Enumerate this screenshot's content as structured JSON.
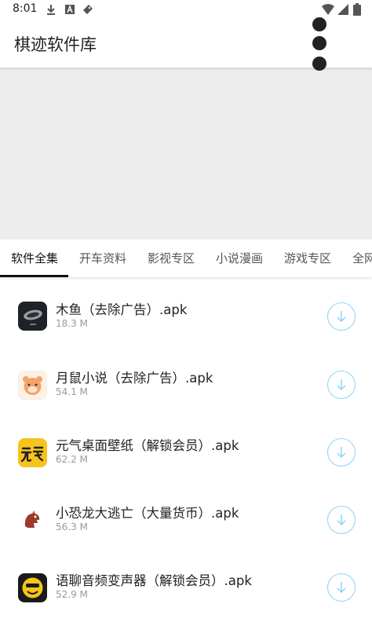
{
  "status_bar": {
    "time": "8:01",
    "left_icons": [
      "download-icon",
      "a-notification-icon",
      "tag-icon"
    ],
    "right_icons": [
      "wifi-icon",
      "signal-icon",
      "battery-icon"
    ]
  },
  "app_bar": {
    "title": "棋迹软件库",
    "menu_icon": "more-vert-icon"
  },
  "tabs": [
    {
      "label": "软件全集",
      "active": true
    },
    {
      "label": "开车资料",
      "active": false
    },
    {
      "label": "影视专区",
      "active": false
    },
    {
      "label": "小说漫画",
      "active": false
    },
    {
      "label": "游戏专区",
      "active": false
    },
    {
      "label": "全网",
      "active": false
    }
  ],
  "apps": [
    {
      "name": "木鱼（去除广告）.apk",
      "size": "18.3 M",
      "icon": "wooden-fish-app-icon"
    },
    {
      "name": "月鼠小说（去除广告）.apk",
      "size": "54.1 M",
      "icon": "hamster-app-icon"
    },
    {
      "name": "元气桌面壁纸（解锁会员）.apk",
      "size": "62.2 M",
      "icon": "yuanqi-app-icon"
    },
    {
      "name": "小恐龙大逃亡（大量货币）.apk",
      "size": "56.3 M",
      "icon": "dinosaur-app-icon"
    },
    {
      "name": "语聊音频变声器（解锁会员）.apk",
      "size": "52.9 M",
      "icon": "voice-changer-app-icon"
    }
  ],
  "colors": {
    "accent_outline": "#8ed3f5",
    "banner_bg": "#ededed"
  }
}
